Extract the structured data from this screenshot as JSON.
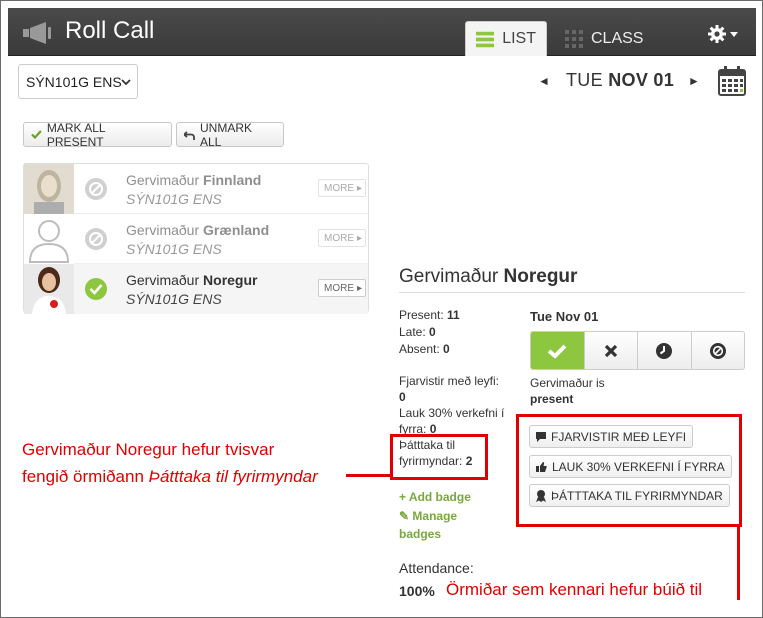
{
  "header": {
    "title": "Roll Call",
    "tabs": [
      {
        "label": "LIST",
        "active": true
      },
      {
        "label": "CLASS",
        "active": false
      }
    ]
  },
  "toolbar": {
    "course_select": "SÝN101G ENS",
    "prev_arrow": "◄",
    "date_day": "TUE",
    "date_rest": "NOV 01",
    "next_arrow": "►"
  },
  "actions": {
    "mark_all": "MARK ALL PRESENT",
    "unmark_all": "UNMARK ALL"
  },
  "students": [
    {
      "first": "Gervimaður",
      "last": "Finnland",
      "course": "SÝN101G ENS",
      "more": "MORE",
      "status": "excused"
    },
    {
      "first": "Gervimaður",
      "last": "Grænland",
      "course": "SÝN101G ENS",
      "more": "MORE",
      "status": "excused"
    },
    {
      "first": "Gervimaður",
      "last": "Noregur",
      "course": "SÝN101G ENS",
      "more": "MORE",
      "status": "present"
    }
  ],
  "detail": {
    "first": "Gervimaður",
    "last": "Noregur",
    "present_label": "Present:",
    "present_val": "11",
    "late_label": "Late:",
    "late_val": "0",
    "absent_label": "Absent:",
    "absent_val": "0",
    "date": "Tue Nov 01",
    "status_prefix": "Gervimaður is",
    "status_word": "present",
    "badge_counts": [
      {
        "label": "Fjarvistir með leyfi:",
        "val": "0"
      },
      {
        "label": "Lauk 30% verkefni í fyrra:",
        "val": "0"
      },
      {
        "label": "Þátttaka til fyrirmyndar:",
        "val": "2"
      }
    ],
    "add_badge": "+ Add badge",
    "manage_badges": "Manage badges",
    "badges": [
      "FJARVISTIR MEÐ LEYFI",
      "LAUK 30% VERKEFNI Í FYRRA",
      "ÞÁTTTAKA TIL FYRIRMYNDAR"
    ],
    "attendance_label": "Attendance:",
    "attendance_val": "100%"
  },
  "annotations": {
    "left_line1": "Gervimaður Noregur hefur tvisvar",
    "left_line2_pre": "fengið örmiðann ",
    "left_line2_italic": "Þátttaka til fyrirmyndar",
    "right": "Örmiðar sem kennari hefur búið til"
  },
  "colors": {
    "accent_green": "#8dc63f",
    "annotation_red": "#e00000",
    "header_bg": "#3f3f3f"
  }
}
